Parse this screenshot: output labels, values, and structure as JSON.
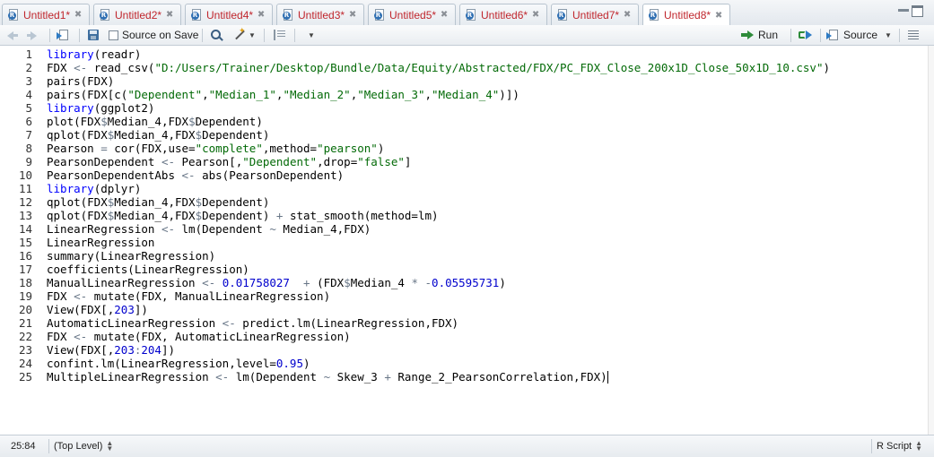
{
  "tabs": [
    {
      "label": "Untitled1*",
      "active": false
    },
    {
      "label": "Untitled2*",
      "active": false
    },
    {
      "label": "Untitled4*",
      "active": false
    },
    {
      "label": "Untitled3*",
      "active": false
    },
    {
      "label": "Untitled5*",
      "active": false
    },
    {
      "label": "Untitled6*",
      "active": false
    },
    {
      "label": "Untitled7*",
      "active": false
    },
    {
      "label": "Untitled8*",
      "active": true
    }
  ],
  "toolbar": {
    "source_on_save_label": "Source on Save",
    "run_label": "Run",
    "source_label": "Source"
  },
  "editor": {
    "lines": [
      {
        "n": "1",
        "tokens": [
          [
            "kw",
            "library"
          ],
          [
            "pl",
            "(readr)"
          ]
        ]
      },
      {
        "n": "2",
        "tokens": [
          [
            "pl",
            "FDX "
          ],
          [
            "op",
            "<-"
          ],
          [
            "pl",
            " read_csv("
          ],
          [
            "str",
            "\"D:/Users/Trainer/Desktop/Bundle/Data/Equity/Abstracted/FDX/PC_FDX_Close_200x1D_Close_50x1D_10.csv\""
          ],
          [
            "pl",
            ")"
          ]
        ]
      },
      {
        "n": "3",
        "tokens": [
          [
            "pl",
            "pairs(FDX)"
          ]
        ]
      },
      {
        "n": "4",
        "tokens": [
          [
            "pl",
            "pairs(FDX[c("
          ],
          [
            "str",
            "\"Dependent\""
          ],
          [
            "pl",
            ","
          ],
          [
            "str",
            "\"Median_1\""
          ],
          [
            "pl",
            ","
          ],
          [
            "str",
            "\"Median_2\""
          ],
          [
            "pl",
            ","
          ],
          [
            "str",
            "\"Median_3\""
          ],
          [
            "pl",
            ","
          ],
          [
            "str",
            "\"Median_4\""
          ],
          [
            "pl",
            ")])"
          ]
        ]
      },
      {
        "n": "5",
        "tokens": [
          [
            "kw",
            "library"
          ],
          [
            "pl",
            "(ggplot2)"
          ]
        ]
      },
      {
        "n": "6",
        "tokens": [
          [
            "pl",
            "plot(FDX"
          ],
          [
            "op",
            "$"
          ],
          [
            "pl",
            "Median_4,FDX"
          ],
          [
            "op",
            "$"
          ],
          [
            "pl",
            "Dependent)"
          ]
        ]
      },
      {
        "n": "7",
        "tokens": [
          [
            "pl",
            "qplot(FDX"
          ],
          [
            "op",
            "$"
          ],
          [
            "pl",
            "Median_4,FDX"
          ],
          [
            "op",
            "$"
          ],
          [
            "pl",
            "Dependent)"
          ]
        ]
      },
      {
        "n": "8",
        "tokens": [
          [
            "pl",
            "Pearson "
          ],
          [
            "op",
            "="
          ],
          [
            "pl",
            " cor(FDX,use="
          ],
          [
            "str",
            "\"complete\""
          ],
          [
            "pl",
            ",method="
          ],
          [
            "str",
            "\"pearson\""
          ],
          [
            "pl",
            ")"
          ]
        ]
      },
      {
        "n": "9",
        "tokens": [
          [
            "pl",
            "PearsonDependent "
          ],
          [
            "op",
            "<-"
          ],
          [
            "pl",
            " Pearson[,"
          ],
          [
            "str",
            "\"Dependent\""
          ],
          [
            "pl",
            ",drop="
          ],
          [
            "str",
            "\"false\""
          ],
          [
            "pl",
            "]"
          ]
        ]
      },
      {
        "n": "10",
        "tokens": [
          [
            "pl",
            "PearsonDependentAbs "
          ],
          [
            "op",
            "<-"
          ],
          [
            "pl",
            " abs(PearsonDependent)"
          ]
        ]
      },
      {
        "n": "11",
        "tokens": [
          [
            "kw",
            "library"
          ],
          [
            "pl",
            "(dplyr)"
          ]
        ]
      },
      {
        "n": "12",
        "tokens": [
          [
            "pl",
            "qplot(FDX"
          ],
          [
            "op",
            "$"
          ],
          [
            "pl",
            "Median_4,FDX"
          ],
          [
            "op",
            "$"
          ],
          [
            "pl",
            "Dependent)"
          ]
        ]
      },
      {
        "n": "13",
        "tokens": [
          [
            "pl",
            "qplot(FDX"
          ],
          [
            "op",
            "$"
          ],
          [
            "pl",
            "Median_4,FDX"
          ],
          [
            "op",
            "$"
          ],
          [
            "pl",
            "Dependent) "
          ],
          [
            "op",
            "+"
          ],
          [
            "pl",
            " stat_smooth(method=lm)"
          ]
        ]
      },
      {
        "n": "14",
        "tokens": [
          [
            "pl",
            "LinearRegression "
          ],
          [
            "op",
            "<-"
          ],
          [
            "pl",
            " lm(Dependent "
          ],
          [
            "op",
            "~"
          ],
          [
            "pl",
            " Median_4,FDX)"
          ]
        ]
      },
      {
        "n": "15",
        "tokens": [
          [
            "pl",
            "LinearRegression"
          ]
        ]
      },
      {
        "n": "16",
        "tokens": [
          [
            "pl",
            "summary(LinearRegression)"
          ]
        ]
      },
      {
        "n": "17",
        "tokens": [
          [
            "pl",
            "coefficients(LinearRegression)"
          ]
        ]
      },
      {
        "n": "18",
        "tokens": [
          [
            "pl",
            "ManualLinearRegression "
          ],
          [
            "op",
            "<-"
          ],
          [
            "pl",
            " "
          ],
          [
            "num",
            "0.01758027"
          ],
          [
            "pl",
            "  "
          ],
          [
            "op",
            "+"
          ],
          [
            "pl",
            " (FDX"
          ],
          [
            "op",
            "$"
          ],
          [
            "pl",
            "Median_4 "
          ],
          [
            "op",
            "*"
          ],
          [
            "pl",
            " "
          ],
          [
            "op",
            "-"
          ],
          [
            "num",
            "0.05595731"
          ],
          [
            "pl",
            ")"
          ]
        ]
      },
      {
        "n": "19",
        "tokens": [
          [
            "pl",
            "FDX "
          ],
          [
            "op",
            "<-"
          ],
          [
            "pl",
            " mutate(FDX, ManualLinearRegression)"
          ]
        ]
      },
      {
        "n": "20",
        "tokens": [
          [
            "pl",
            "View(FDX[,"
          ],
          [
            "num",
            "203"
          ],
          [
            "pl",
            "])"
          ]
        ]
      },
      {
        "n": "21",
        "tokens": [
          [
            "pl",
            "AutomaticLinearRegression "
          ],
          [
            "op",
            "<-"
          ],
          [
            "pl",
            " predict.lm(LinearRegression,FDX)"
          ]
        ]
      },
      {
        "n": "22",
        "tokens": [
          [
            "pl",
            "FDX "
          ],
          [
            "op",
            "<-"
          ],
          [
            "pl",
            " mutate(FDX, AutomaticLinearRegression)"
          ]
        ]
      },
      {
        "n": "23",
        "tokens": [
          [
            "pl",
            "View(FDX[,"
          ],
          [
            "num",
            "203"
          ],
          [
            "op",
            ":"
          ],
          [
            "num",
            "204"
          ],
          [
            "pl",
            "])"
          ]
        ]
      },
      {
        "n": "24",
        "tokens": [
          [
            "pl",
            "confint.lm(LinearRegression,level="
          ],
          [
            "num",
            "0.95"
          ],
          [
            "pl",
            ")"
          ]
        ]
      },
      {
        "n": "25",
        "tokens": [
          [
            "pl",
            "MultipleLinearRegression "
          ],
          [
            "op",
            "<-"
          ],
          [
            "pl",
            " lm(Dependent "
          ],
          [
            "op",
            "~"
          ],
          [
            "pl",
            " Skew_3 "
          ],
          [
            "op",
            "+"
          ],
          [
            "pl",
            " Range_2_PearsonCorrelation,FDX)"
          ]
        ]
      }
    ]
  },
  "status": {
    "cursor_position": "25:84",
    "scope": "(Top Level)",
    "file_type": "R Script"
  },
  "colors": {
    "keyword": "#0000ff",
    "string": "#036a07",
    "number": "#0000cd",
    "operator": "#687687",
    "tab_label": "#c0262d"
  }
}
